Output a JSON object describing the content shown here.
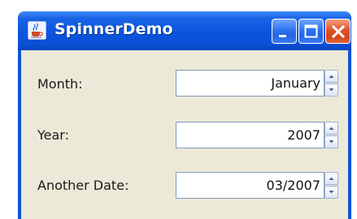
{
  "window": {
    "title": "SpinnerDemo",
    "icon": "java-coffee-cup-icon",
    "buttons": [
      "minimize",
      "maximize",
      "close"
    ]
  },
  "form": {
    "rows": [
      {
        "label": "Month:",
        "value": "January"
      },
      {
        "label": "Year:",
        "value": "2007"
      },
      {
        "label": "Another Date:",
        "value": "03/2007"
      }
    ]
  },
  "colors": {
    "titlebar": "#0a55de",
    "content_bg": "#ece9d8",
    "field_border": "#7f9db9",
    "close_button": "#e0532a"
  }
}
